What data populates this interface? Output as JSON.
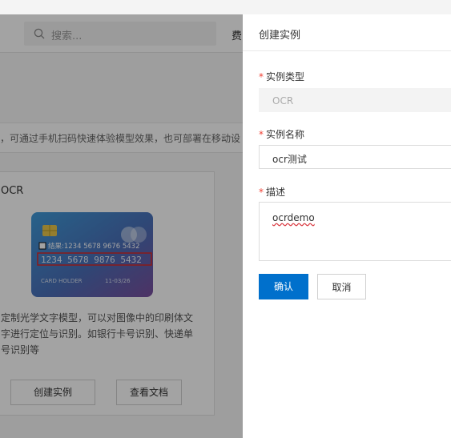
{
  "background": {
    "search_placeholder": "搜索...",
    "header_truncated_text": "费",
    "description_bar": "，可通过手机扫码快速体验模型效果，也可部署在移动设",
    "card": {
      "title": "OCR",
      "description": "定制光学文字模型，可以对图像中的印刷体文字进行定位与识别。如银行卡号识别、快递单号识别等",
      "create_button": "创建实例",
      "docs_button": "查看文档",
      "card_image": {
        "result_text": "结果:1234 5678 9676 5432",
        "number_text": "1234 5678 9876 5432",
        "holder_text": "CARD HOLDER",
        "date_text": "11-03/26"
      }
    }
  },
  "drawer": {
    "title": "创建实例",
    "required_mark": "*",
    "type_label": "实例类型",
    "type_value": "OCR",
    "name_label": "实例名称",
    "name_value": "ocr测试",
    "desc_label": "描述",
    "desc_value": "ocrdemo",
    "confirm_button": "确认",
    "cancel_button": "取消"
  },
  "colors": {
    "primary": "#0070cc",
    "required": "#f04134",
    "mask": "rgba(0,0,0,0.36)"
  }
}
